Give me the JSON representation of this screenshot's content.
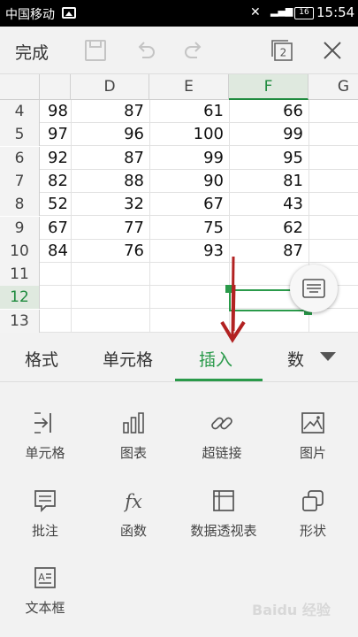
{
  "status_bar": {
    "carrier": "中国移动",
    "battery": "16",
    "time": "15:54",
    "icons": [
      "gallery-icon",
      "mute-icon",
      "signal-icon",
      "battery-icon"
    ]
  },
  "toolbar": {
    "done_label": "完成",
    "page_count": "2",
    "icons": [
      "save-icon",
      "undo-icon",
      "redo-icon",
      "window-switch-icon",
      "close-icon"
    ]
  },
  "sheet": {
    "columns": [
      "D",
      "E",
      "F",
      "G"
    ],
    "selected_column": "F",
    "rows": [
      {
        "num": "4",
        "cells": [
          "98",
          "87",
          "61",
          "66"
        ]
      },
      {
        "num": "5",
        "cells": [
          "97",
          "96",
          "100",
          "99"
        ]
      },
      {
        "num": "6",
        "cells": [
          "92",
          "87",
          "99",
          "95"
        ]
      },
      {
        "num": "7",
        "cells": [
          "82",
          "88",
          "90",
          "81"
        ]
      },
      {
        "num": "8",
        "cells": [
          "52",
          "32",
          "67",
          "43"
        ]
      },
      {
        "num": "9",
        "cells": [
          "67",
          "77",
          "75",
          "62"
        ]
      },
      {
        "num": "10",
        "cells": [
          "84",
          "76",
          "93",
          "87"
        ]
      },
      {
        "num": "11",
        "cells": [
          "",
          "",
          "",
          ""
        ]
      },
      {
        "num": "12",
        "cells": [
          "",
          "",
          "",
          ""
        ]
      },
      {
        "num": "13",
        "cells": [
          "",
          "",
          "",
          ""
        ]
      }
    ],
    "selected_row": "12",
    "accent_color": "#2a9a4a",
    "annotation_color": "#b22222"
  },
  "tabs": [
    {
      "label": "格式"
    },
    {
      "label": "单元格"
    },
    {
      "label": "插入",
      "active": true
    },
    {
      "label": "数"
    }
  ],
  "insert_items": [
    {
      "label": "单元格",
      "icon": "insert-cell-icon"
    },
    {
      "label": "图表",
      "icon": "chart-icon"
    },
    {
      "label": "超链接",
      "icon": "hyperlink-icon"
    },
    {
      "label": "图片",
      "icon": "picture-icon"
    },
    {
      "label": "批注",
      "icon": "comment-icon"
    },
    {
      "label": "函数",
      "icon": "function-icon"
    },
    {
      "label": "数据透视表",
      "icon": "pivot-table-icon"
    },
    {
      "label": "形状",
      "icon": "shape-icon"
    },
    {
      "label": "文本框",
      "icon": "textbox-icon"
    }
  ],
  "watermark": "Baidu 经验"
}
